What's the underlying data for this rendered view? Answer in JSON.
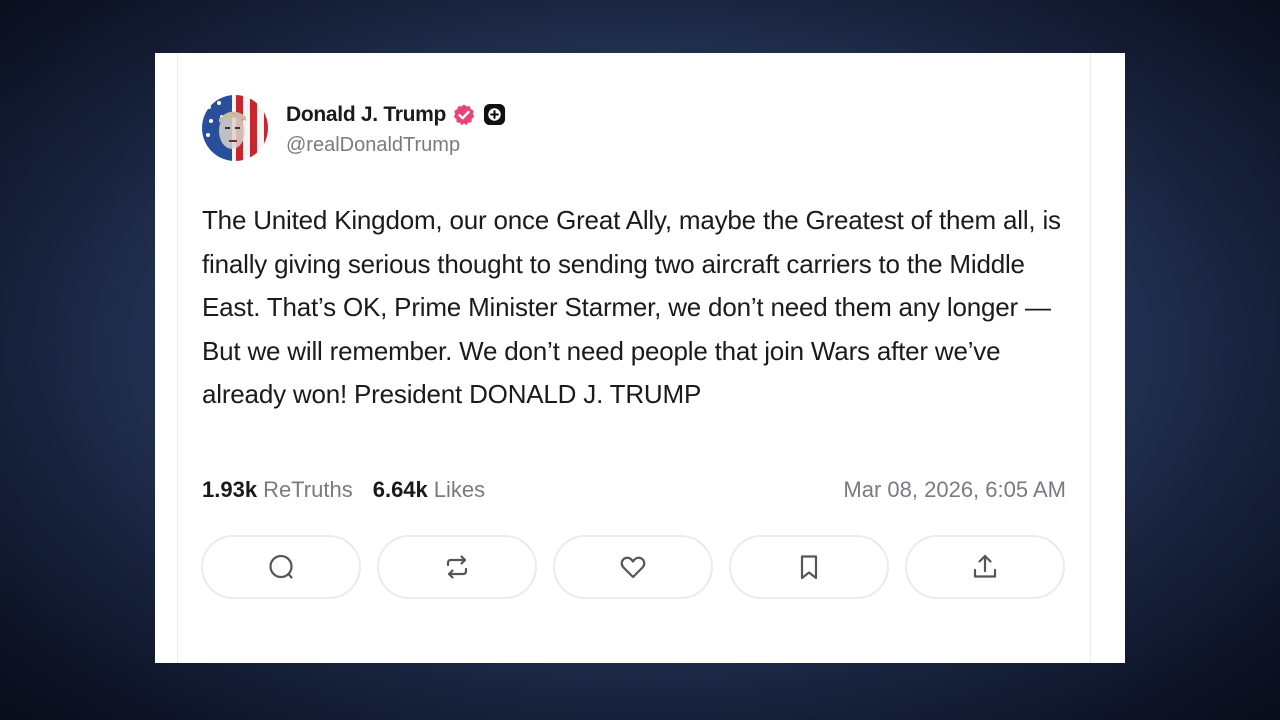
{
  "post": {
    "display_name": "Donald J. Trump",
    "handle": "@realDonaldTrump",
    "text": "The United Kingdom, our once Great Ally, maybe the Greatest of them all, is finally giving serious thought to sending two aircraft carriers to the Middle East. That’s OK, Prime Minister Starmer, we don’t need them any longer — But we will remember. We don’t need people that join Wars after we’ve already won! President DONALD J. TRUMP",
    "retruths_count": "1.93k",
    "retruths_label": "ReTruths",
    "likes_count": "6.64k",
    "likes_label": "Likes",
    "timestamp": "Mar 08, 2026, 6:05 AM"
  },
  "icons": {
    "avatar": "avatar-flag-portrait",
    "verified": "verified-badge-icon",
    "plus": "plus-badge-icon",
    "actions": [
      "reply-icon",
      "retruth-icon",
      "like-icon",
      "bookmark-icon",
      "share-icon"
    ]
  },
  "colors": {
    "verified_badge": "#e9447a",
    "text": "#1b1b1f",
    "muted": "#7a7a82",
    "background": "#243356"
  }
}
